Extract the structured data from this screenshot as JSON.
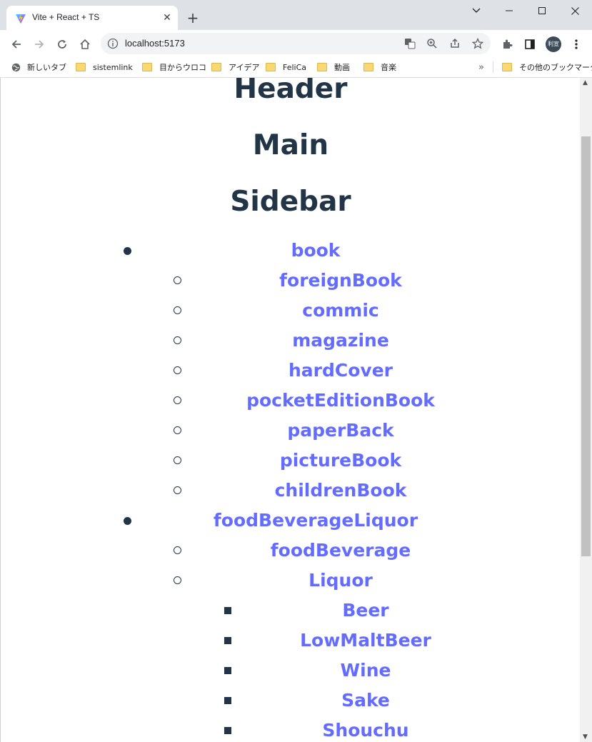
{
  "browser": {
    "tab_title": "Vite + React + TS",
    "url": "localhost:5173",
    "profile_label": "利宣",
    "bookmarks": [
      "新しいタブ",
      "sistemlink",
      "目からウロコ",
      "アイデア",
      "FeliCa",
      "動画",
      "音楽"
    ],
    "more_bookmarks_label": "»",
    "other_bookmarks": "その他のブックマーク"
  },
  "page": {
    "headings": [
      "Header",
      "Main",
      "Sidebar"
    ],
    "categories": [
      {
        "label": "book",
        "children": [
          {
            "label": "foreignBook"
          },
          {
            "label": "commic"
          },
          {
            "label": "magazine"
          },
          {
            "label": "hardCover"
          },
          {
            "label": "pocketEditionBook"
          },
          {
            "label": "paperBack"
          },
          {
            "label": "pictureBook"
          },
          {
            "label": "childrenBook"
          }
        ]
      },
      {
        "label": "foodBeverageLiquor",
        "children": [
          {
            "label": "foodBeverage"
          },
          {
            "label": "Liquor",
            "children": [
              "Beer",
              "LowMaltBeer",
              "Wine",
              "Sake",
              "Shouchu"
            ]
          }
        ]
      }
    ]
  },
  "colors": {
    "link": "#646cff",
    "text": "#213547"
  }
}
